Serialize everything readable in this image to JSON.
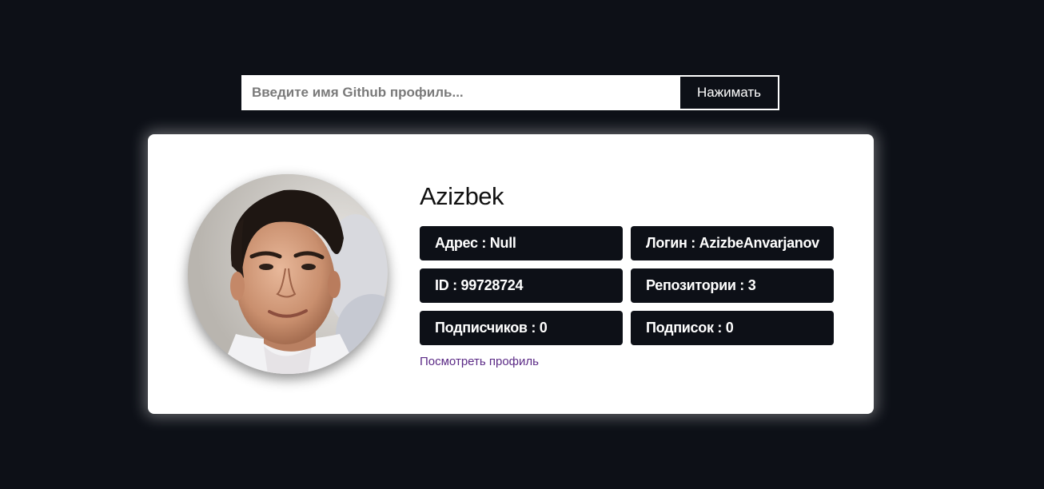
{
  "search": {
    "placeholder": "Введите имя Github профиль...",
    "value": "",
    "button_label": "Нажимать"
  },
  "profile": {
    "name": "Azizbek",
    "stats": [
      {
        "label": "Адрес",
        "value": "Null",
        "text": "Адрес : Null"
      },
      {
        "label": "Логин",
        "value": "AzizbeAnvarjanov",
        "text": "Логин : AzizbeAnvarjanov"
      },
      {
        "label": "ID",
        "value": "99728724",
        "text": "ID : 99728724"
      },
      {
        "label": "Репозитории",
        "value": "3",
        "text": "Репозитории : 3"
      },
      {
        "label": "Подписчиков",
        "value": "0",
        "text": "Подписчиков : 0"
      },
      {
        "label": "Подписок",
        "value": "0",
        "text": "Подписок : 0"
      }
    ],
    "view_profile_label": "Посмотреть профиль"
  },
  "colors": {
    "background": "#0d1017",
    "card": "#ffffff",
    "stat_box": "#0d1017",
    "link": "#5b2a86"
  }
}
